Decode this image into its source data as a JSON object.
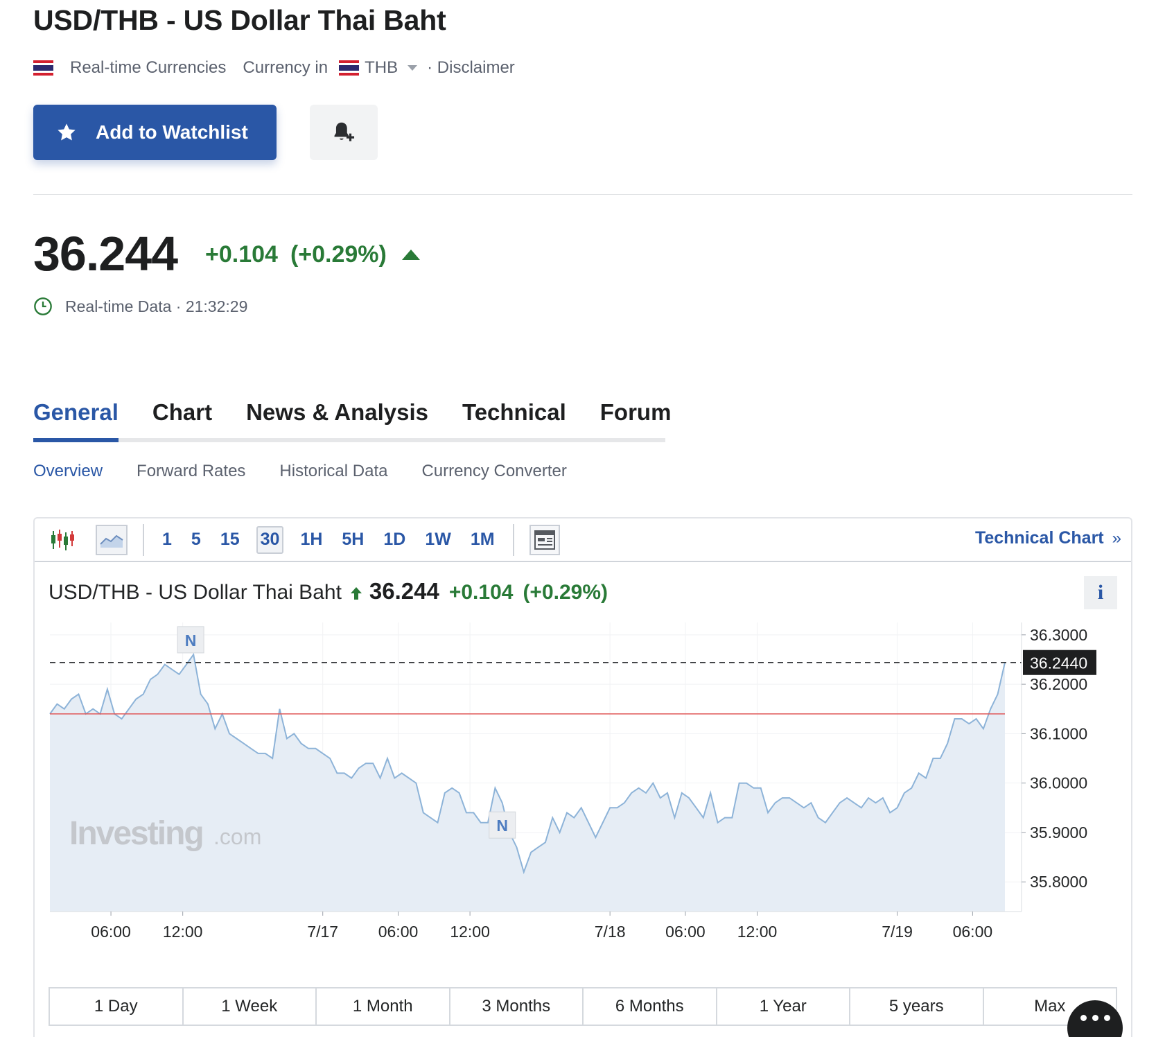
{
  "header": {
    "title": "USD/THB - US Dollar Thai Baht",
    "realtime_label": "Real-time Currencies",
    "currency_prefix": "Currency in",
    "currency": "THB",
    "disclaimer": "· Disclaimer"
  },
  "actions": {
    "watchlist_label": "Add to Watchlist"
  },
  "quote": {
    "price": "36.244",
    "change": "+0.104",
    "change_pct": "(+0.29%)",
    "status": "Real-time Data · 21:32:29"
  },
  "colors": {
    "accent": "#2a57a6",
    "positive": "#297a37",
    "line": "#8db3d8",
    "area": "#e6edf5",
    "prev_close": "#e05a5a"
  },
  "tabs": [
    {
      "label": "General",
      "active": true
    },
    {
      "label": "Chart"
    },
    {
      "label": "News & Analysis"
    },
    {
      "label": "Technical"
    },
    {
      "label": "Forum"
    }
  ],
  "subtabs": [
    {
      "label": "Overview",
      "active": true
    },
    {
      "label": "Forward Rates"
    },
    {
      "label": "Historical Data"
    },
    {
      "label": "Currency Converter"
    }
  ],
  "chart_toolbar": {
    "intervals": [
      "1",
      "5",
      "15",
      "30",
      "1H",
      "5H",
      "1D",
      "1W",
      "1M"
    ],
    "selected_interval": "30",
    "technical_link": "Technical Chart"
  },
  "chart_header": {
    "title": "USD/THB - US Dollar Thai Baht",
    "price": "36.244",
    "change": "+0.104",
    "change_pct": "(+0.29%)",
    "info": "i"
  },
  "ranges": [
    "1 Day",
    "1 Week",
    "1 Month",
    "3 Months",
    "6 Months",
    "1 Year",
    "5 years",
    "Max"
  ],
  "watermark": {
    "brand": "Investing",
    "suffix": ".com"
  },
  "chart_data": {
    "type": "area",
    "ylim": [
      35.74,
      36.325
    ],
    "yticks": [
      "36.3000",
      "36.2000",
      "36.1000",
      "36.0000",
      "35.9000",
      "35.8000"
    ],
    "ytick_values": [
      36.3,
      36.2,
      36.1,
      36.0,
      35.9,
      35.8
    ],
    "current_value": 36.244,
    "current_label": "36.2440",
    "prev_close": 36.14,
    "xlim": [
      0,
      133
    ],
    "xticks": [
      {
        "label": "06:00",
        "x": 8.5
      },
      {
        "label": "12:00",
        "x": 18.5
      },
      {
        "label": "7/17",
        "x": 38.0
      },
      {
        "label": "06:00",
        "x": 48.5
      },
      {
        "label": "12:00",
        "x": 58.5
      },
      {
        "label": "7/18",
        "x": 78.0
      },
      {
        "label": "06:00",
        "x": 88.5
      },
      {
        "label": "12:00",
        "x": 98.5
      },
      {
        "label": "7/19",
        "x": 118.0
      },
      {
        "label": "06:00",
        "x": 128.5
      }
    ],
    "news_markers": [
      {
        "label": "N",
        "x": 19.6,
        "y": 36.255
      },
      {
        "label": "N",
        "x": 63.0,
        "y": 35.88
      }
    ],
    "values": [
      36.14,
      36.16,
      36.15,
      36.17,
      36.18,
      36.14,
      36.15,
      36.14,
      36.19,
      36.14,
      36.13,
      36.15,
      36.17,
      36.18,
      36.21,
      36.22,
      36.24,
      36.23,
      36.22,
      36.24,
      36.26,
      36.18,
      36.16,
      36.11,
      36.14,
      36.1,
      36.09,
      36.08,
      36.07,
      36.06,
      36.06,
      36.05,
      36.15,
      36.09,
      36.1,
      36.08,
      36.07,
      36.07,
      36.06,
      36.05,
      36.02,
      36.02,
      36.01,
      36.03,
      36.04,
      36.04,
      36.01,
      36.05,
      36.01,
      36.02,
      36.01,
      36.0,
      35.94,
      35.93,
      35.92,
      35.98,
      35.99,
      35.98,
      35.94,
      35.94,
      35.92,
      35.92,
      35.99,
      35.96,
      35.9,
      35.87,
      35.82,
      35.86,
      35.87,
      35.88,
      35.93,
      35.9,
      35.94,
      35.93,
      35.95,
      35.92,
      35.89,
      35.92,
      35.95,
      35.95,
      35.96,
      35.98,
      35.99,
      35.98,
      36.0,
      35.97,
      35.98,
      35.93,
      35.98,
      35.97,
      35.95,
      35.93,
      35.98,
      35.92,
      35.93,
      35.93,
      36.0,
      36.0,
      35.99,
      35.99,
      35.94,
      35.96,
      35.97,
      35.97,
      35.96,
      35.95,
      35.96,
      35.93,
      35.92,
      35.94,
      35.96,
      35.97,
      35.96,
      35.95,
      35.97,
      35.96,
      35.97,
      35.94,
      35.95,
      35.98,
      35.99,
      36.02,
      36.01,
      36.05,
      36.05,
      36.08,
      36.13,
      36.13,
      36.12,
      36.13,
      36.11,
      36.15,
      36.18,
      36.244
    ]
  }
}
